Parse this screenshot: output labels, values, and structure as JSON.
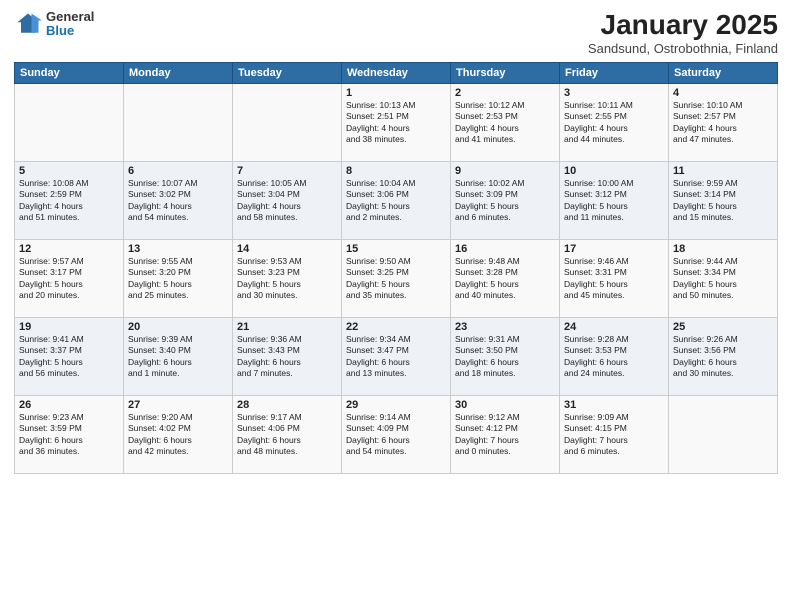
{
  "logo": {
    "general": "General",
    "blue": "Blue"
  },
  "header": {
    "month": "January 2025",
    "location": "Sandsund, Ostrobothnia, Finland"
  },
  "weekdays": [
    "Sunday",
    "Monday",
    "Tuesday",
    "Wednesday",
    "Thursday",
    "Friday",
    "Saturday"
  ],
  "weeks": [
    [
      {
        "day": "",
        "info": ""
      },
      {
        "day": "",
        "info": ""
      },
      {
        "day": "",
        "info": ""
      },
      {
        "day": "1",
        "info": "Sunrise: 10:13 AM\nSunset: 2:51 PM\nDaylight: 4 hours\nand 38 minutes."
      },
      {
        "day": "2",
        "info": "Sunrise: 10:12 AM\nSunset: 2:53 PM\nDaylight: 4 hours\nand 41 minutes."
      },
      {
        "day": "3",
        "info": "Sunrise: 10:11 AM\nSunset: 2:55 PM\nDaylight: 4 hours\nand 44 minutes."
      },
      {
        "day": "4",
        "info": "Sunrise: 10:10 AM\nSunset: 2:57 PM\nDaylight: 4 hours\nand 47 minutes."
      }
    ],
    [
      {
        "day": "5",
        "info": "Sunrise: 10:08 AM\nSunset: 2:59 PM\nDaylight: 4 hours\nand 51 minutes."
      },
      {
        "day": "6",
        "info": "Sunrise: 10:07 AM\nSunset: 3:02 PM\nDaylight: 4 hours\nand 54 minutes."
      },
      {
        "day": "7",
        "info": "Sunrise: 10:05 AM\nSunset: 3:04 PM\nDaylight: 4 hours\nand 58 minutes."
      },
      {
        "day": "8",
        "info": "Sunrise: 10:04 AM\nSunset: 3:06 PM\nDaylight: 5 hours\nand 2 minutes."
      },
      {
        "day": "9",
        "info": "Sunrise: 10:02 AM\nSunset: 3:09 PM\nDaylight: 5 hours\nand 6 minutes."
      },
      {
        "day": "10",
        "info": "Sunrise: 10:00 AM\nSunset: 3:12 PM\nDaylight: 5 hours\nand 11 minutes."
      },
      {
        "day": "11",
        "info": "Sunrise: 9:59 AM\nSunset: 3:14 PM\nDaylight: 5 hours\nand 15 minutes."
      }
    ],
    [
      {
        "day": "12",
        "info": "Sunrise: 9:57 AM\nSunset: 3:17 PM\nDaylight: 5 hours\nand 20 minutes."
      },
      {
        "day": "13",
        "info": "Sunrise: 9:55 AM\nSunset: 3:20 PM\nDaylight: 5 hours\nand 25 minutes."
      },
      {
        "day": "14",
        "info": "Sunrise: 9:53 AM\nSunset: 3:23 PM\nDaylight: 5 hours\nand 30 minutes."
      },
      {
        "day": "15",
        "info": "Sunrise: 9:50 AM\nSunset: 3:25 PM\nDaylight: 5 hours\nand 35 minutes."
      },
      {
        "day": "16",
        "info": "Sunrise: 9:48 AM\nSunset: 3:28 PM\nDaylight: 5 hours\nand 40 minutes."
      },
      {
        "day": "17",
        "info": "Sunrise: 9:46 AM\nSunset: 3:31 PM\nDaylight: 5 hours\nand 45 minutes."
      },
      {
        "day": "18",
        "info": "Sunrise: 9:44 AM\nSunset: 3:34 PM\nDaylight: 5 hours\nand 50 minutes."
      }
    ],
    [
      {
        "day": "19",
        "info": "Sunrise: 9:41 AM\nSunset: 3:37 PM\nDaylight: 5 hours\nand 56 minutes."
      },
      {
        "day": "20",
        "info": "Sunrise: 9:39 AM\nSunset: 3:40 PM\nDaylight: 6 hours\nand 1 minute."
      },
      {
        "day": "21",
        "info": "Sunrise: 9:36 AM\nSunset: 3:43 PM\nDaylight: 6 hours\nand 7 minutes."
      },
      {
        "day": "22",
        "info": "Sunrise: 9:34 AM\nSunset: 3:47 PM\nDaylight: 6 hours\nand 13 minutes."
      },
      {
        "day": "23",
        "info": "Sunrise: 9:31 AM\nSunset: 3:50 PM\nDaylight: 6 hours\nand 18 minutes."
      },
      {
        "day": "24",
        "info": "Sunrise: 9:28 AM\nSunset: 3:53 PM\nDaylight: 6 hours\nand 24 minutes."
      },
      {
        "day": "25",
        "info": "Sunrise: 9:26 AM\nSunset: 3:56 PM\nDaylight: 6 hours\nand 30 minutes."
      }
    ],
    [
      {
        "day": "26",
        "info": "Sunrise: 9:23 AM\nSunset: 3:59 PM\nDaylight: 6 hours\nand 36 minutes."
      },
      {
        "day": "27",
        "info": "Sunrise: 9:20 AM\nSunset: 4:02 PM\nDaylight: 6 hours\nand 42 minutes."
      },
      {
        "day": "28",
        "info": "Sunrise: 9:17 AM\nSunset: 4:06 PM\nDaylight: 6 hours\nand 48 minutes."
      },
      {
        "day": "29",
        "info": "Sunrise: 9:14 AM\nSunset: 4:09 PM\nDaylight: 6 hours\nand 54 minutes."
      },
      {
        "day": "30",
        "info": "Sunrise: 9:12 AM\nSunset: 4:12 PM\nDaylight: 7 hours\nand 0 minutes."
      },
      {
        "day": "31",
        "info": "Sunrise: 9:09 AM\nSunset: 4:15 PM\nDaylight: 7 hours\nand 6 minutes."
      },
      {
        "day": "",
        "info": ""
      }
    ]
  ]
}
